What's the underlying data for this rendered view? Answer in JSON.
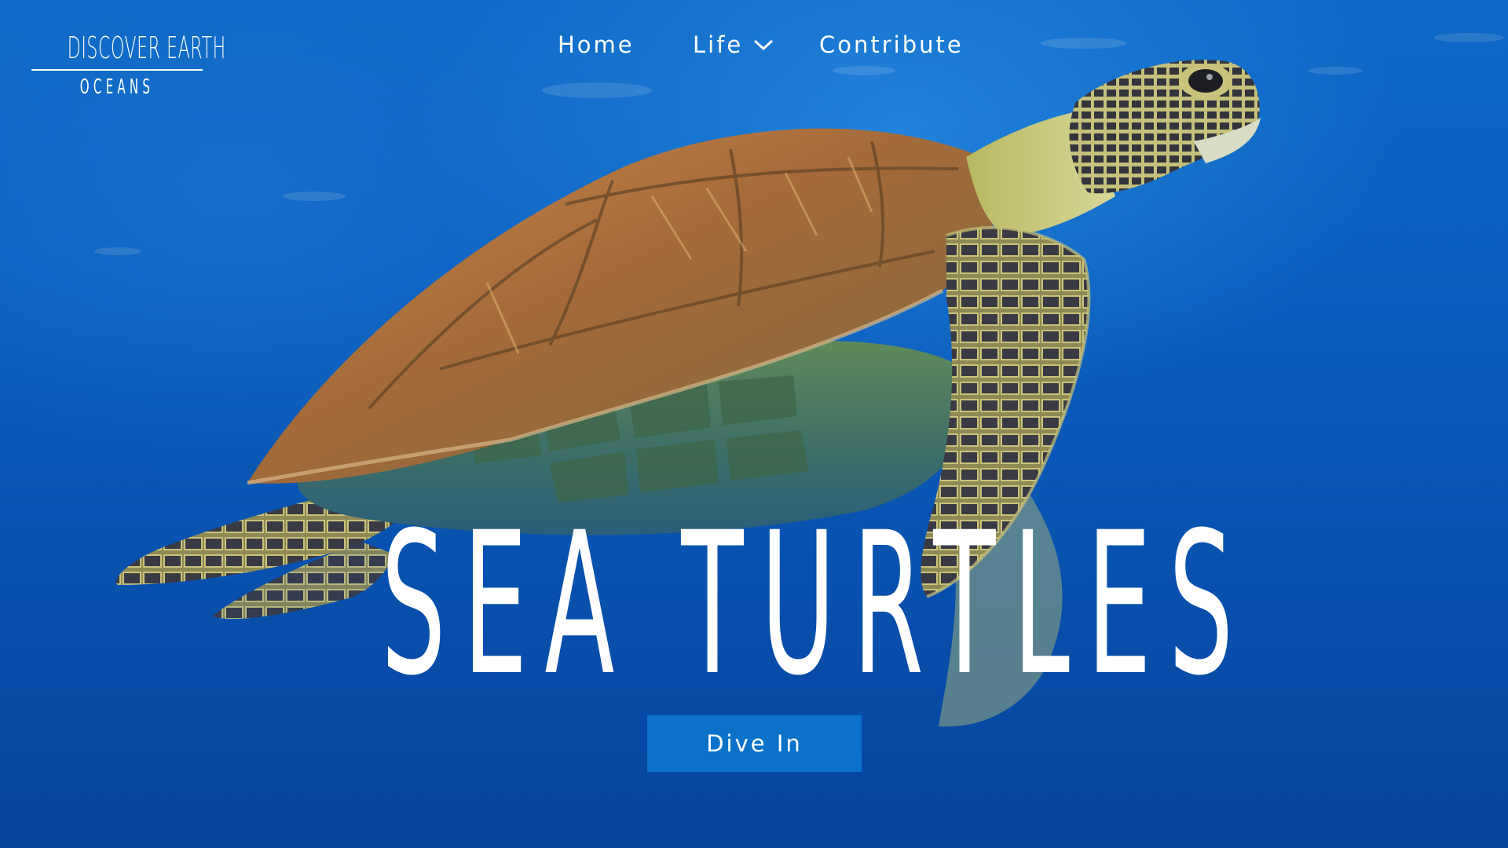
{
  "logo": {
    "title": "DISCOVER EARTH",
    "subtitle": "OCEANS"
  },
  "nav": {
    "items": [
      {
        "label": "Home"
      },
      {
        "label": "Life",
        "icon": "chevron-down-icon"
      },
      {
        "label": "Contribute"
      }
    ]
  },
  "hero": {
    "title": "SEA TURTLES",
    "image": "sea-turtle-swimming-underwater",
    "cta_label": "Dive In"
  },
  "colors": {
    "ocean_top": "#0d69c6",
    "ocean_bottom": "#06449e",
    "button": "#0a72c9",
    "text": "#ffffff"
  }
}
